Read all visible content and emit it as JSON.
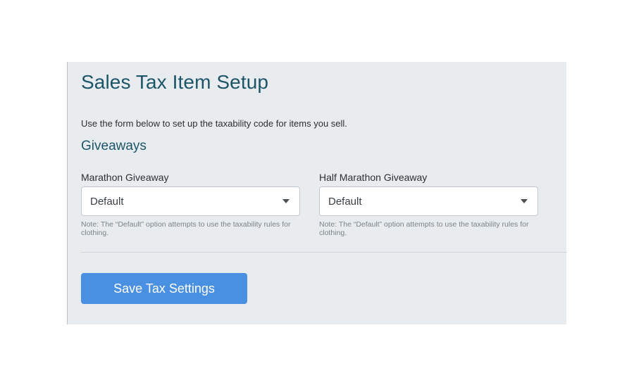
{
  "page": {
    "title": "Sales Tax Item Setup",
    "intro": "Use the form below to set up the taxability code for items you sell."
  },
  "section": {
    "title": "Giveaways",
    "fields": [
      {
        "label": "Marathon Giveaway",
        "value": "Default",
        "note": "Note: The “Default” option attempts to use the taxability rules for clothing."
      },
      {
        "label": "Half Marathon Giveaway",
        "value": "Default",
        "note": "Note: The “Default” option attempts to use the taxability rules for clothing."
      }
    ]
  },
  "actions": {
    "save_label": "Save Tax Settings"
  },
  "colors": {
    "heading": "#1d5568",
    "panel_background": "#e8ecef",
    "button": "#4a90e2"
  },
  "icons": {
    "dropdown": "chevron-down-icon"
  }
}
